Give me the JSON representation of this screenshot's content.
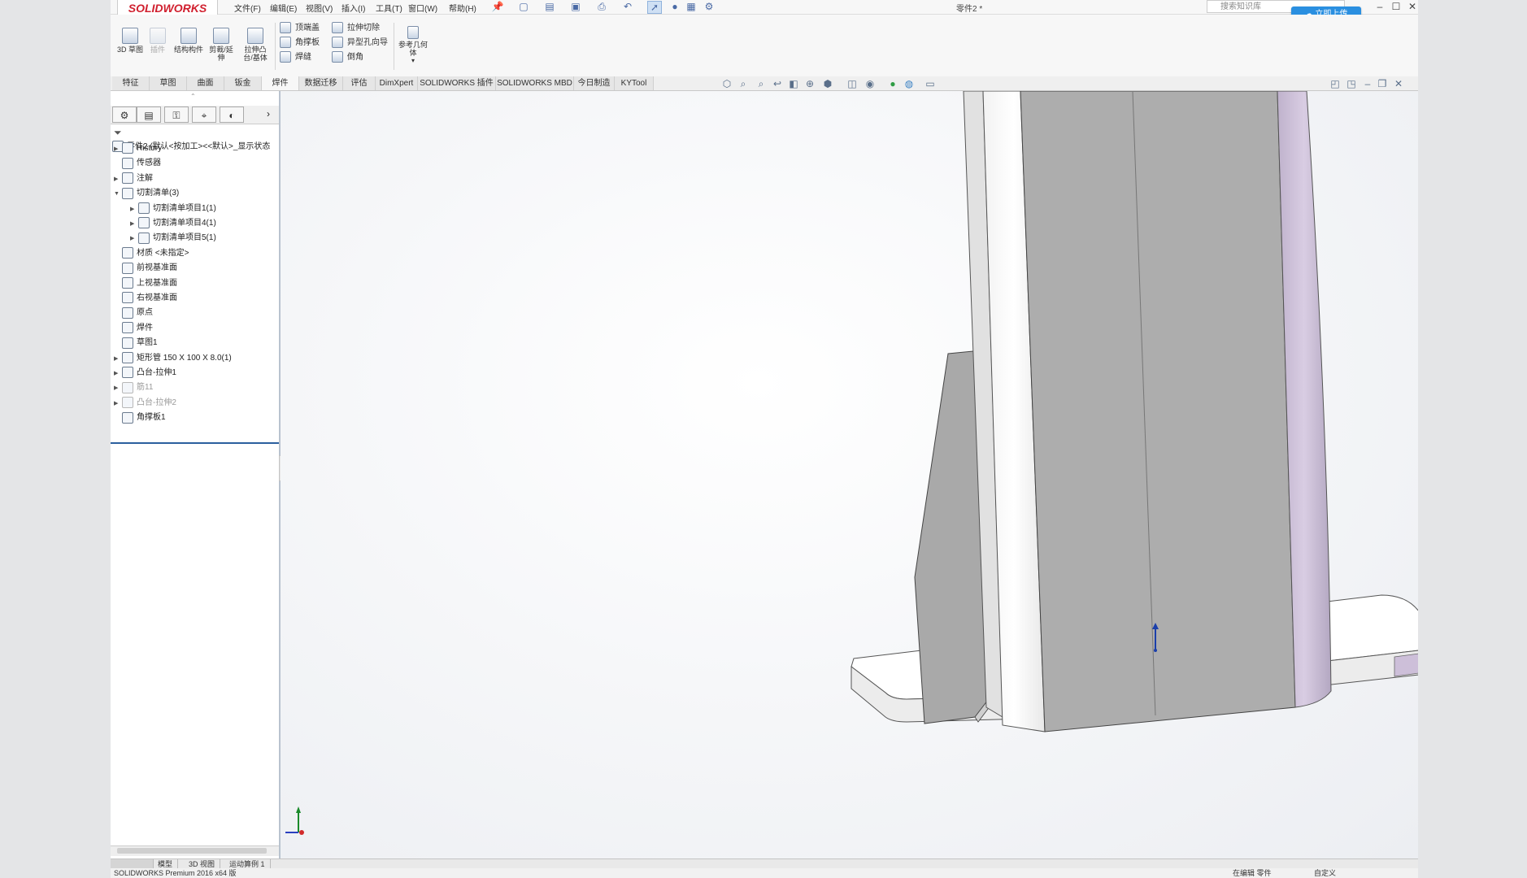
{
  "app": {
    "logo": "SOLIDWORKS",
    "window_title": "零件2 *",
    "menus": [
      "文件(F)",
      "编辑(E)",
      "视图(V)",
      "插入(I)",
      "工具(T)",
      "窗口(W)",
      "帮助(H)"
    ],
    "search_placeholder": "搜索知识库",
    "upload_label": "立即上传"
  },
  "ribbon": {
    "big_buttons": [
      {
        "label": "3D 草图",
        "icon": "sketch3d-icon"
      },
      {
        "label": "插件",
        "icon": "plugin-icon"
      },
      {
        "label": "结构构件",
        "icon": "structural-member-icon"
      },
      {
        "label": "剪裁/延伸",
        "icon": "trim-extend-icon"
      },
      {
        "label": "拉伸凸台/基体",
        "icon": "extrude-boss-icon"
      }
    ],
    "small_col1": [
      "顶端盖",
      "角撑板",
      "焊缝"
    ],
    "small_col2": [
      "拉伸切除",
      "异型孔向导",
      "倒角"
    ],
    "ref_geom": "参考几何体"
  },
  "tabs": [
    "特征",
    "草图",
    "曲面",
    "钣金",
    "焊件",
    "数据迁移",
    "评估",
    "DimXpert",
    "SOLIDWORKS 插件",
    "SOLIDWORKS MBD",
    "今日制造",
    "KYTool"
  ],
  "active_tab": "焊件",
  "tree": {
    "root": "零件2 (默认<按加工><<默认>_显示状态",
    "nodes": [
      {
        "label": "History",
        "icon": "history-icon",
        "arrow": true,
        "indent": 0
      },
      {
        "label": "传感器",
        "icon": "sensor-icon",
        "arrow": false,
        "indent": 0
      },
      {
        "label": "注解",
        "icon": "annotation-icon",
        "arrow": true,
        "indent": 0
      },
      {
        "label": "切割清单(3)",
        "icon": "cutlist-icon",
        "arrow": true,
        "indent": 0,
        "open": true
      },
      {
        "label": "切割清单项目1(1)",
        "icon": "cutlist-item-icon",
        "arrow": true,
        "indent": 1
      },
      {
        "label": "切割清单项目4(1)",
        "icon": "folder-icon",
        "arrow": true,
        "indent": 1
      },
      {
        "label": "切割清单项目5(1)",
        "icon": "folder-icon",
        "arrow": true,
        "indent": 1
      },
      {
        "label": "材质 <未指定>",
        "icon": "material-icon",
        "arrow": false,
        "indent": 0
      },
      {
        "label": "前视基准面",
        "icon": "plane-icon",
        "arrow": false,
        "indent": 0
      },
      {
        "label": "上视基准面",
        "icon": "plane-icon",
        "arrow": false,
        "indent": 0
      },
      {
        "label": "右视基准面",
        "icon": "plane-icon",
        "arrow": false,
        "indent": 0
      },
      {
        "label": "原点",
        "icon": "origin-icon",
        "arrow": false,
        "indent": 0
      },
      {
        "label": "焊件",
        "icon": "weldment-icon",
        "arrow": false,
        "indent": 0
      },
      {
        "label": "草图1",
        "icon": "sketch-icon",
        "arrow": false,
        "indent": 0
      },
      {
        "label": "矩形管 150 X 100 X 8.0(1)",
        "icon": "tube-icon",
        "arrow": true,
        "indent": 0
      },
      {
        "label": "凸台-拉伸1",
        "icon": "extrude-icon",
        "arrow": true,
        "indent": 0
      },
      {
        "label": "筋11",
        "icon": "rib-icon",
        "arrow": true,
        "indent": 0,
        "dim": true
      },
      {
        "label": "凸台-拉伸2",
        "icon": "extrude-icon",
        "arrow": true,
        "indent": 0,
        "dim": true
      },
      {
        "label": "角撑板1",
        "icon": "gusset-icon",
        "arrow": false,
        "indent": 0
      }
    ]
  },
  "bottom_tabs": [
    "模型",
    "3D 视图",
    "运动算例 1"
  ],
  "status": {
    "left": "SOLIDWORKS Premium 2016 x64 版",
    "middle": "在编辑 零件",
    "right": "自定义"
  },
  "colors": {
    "accent": "#2a8fe0",
    "brand": "#d01f2e",
    "part": "#adadad",
    "part_edge": "#c7b8d6"
  }
}
